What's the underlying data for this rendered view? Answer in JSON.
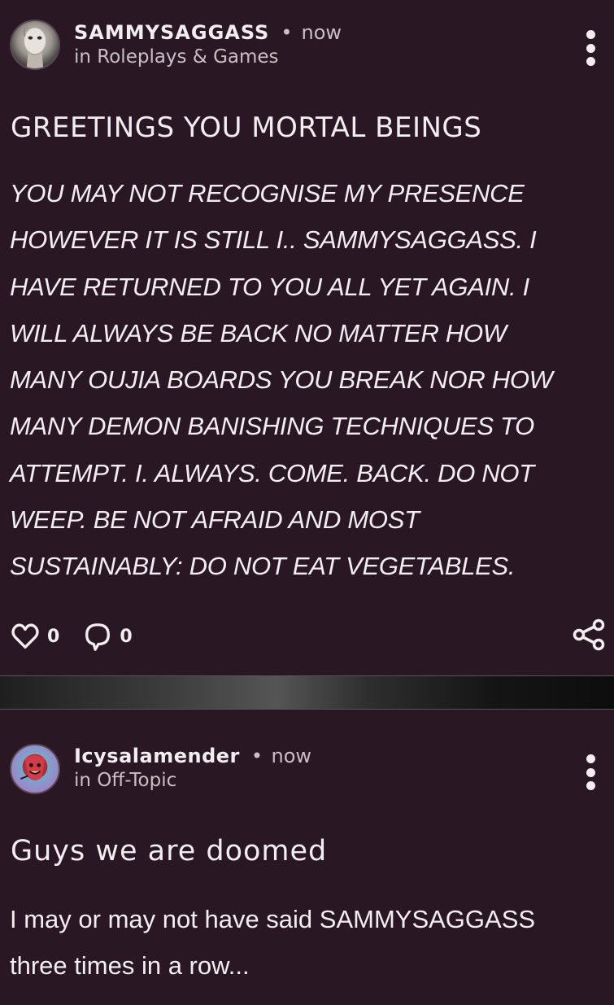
{
  "posts": [
    {
      "author": "SAMMYSAGGASS",
      "separator": "•",
      "time": "now",
      "community": "in Roleplays & Games",
      "title": "GREETINGS YOU MORTAL BEINGS",
      "body_lines": [
        "YOU MAY NOT RECOGNISE MY PRESENCE",
        "HOWEVER IT IS STILL I.. SAMMYSAGGASS. I",
        "HAVE RETURNED TO YOU ALL YET AGAIN. I",
        "WILL ALWAYS BE BACK NO MATTER HOW",
        "MANY OUJIA BOARDS YOU BREAK NOR HOW",
        "MANY DEMON BANISHING TECHNIQUES TO",
        "ATTEMPT. I. ALWAYS. COME. BACK. DO NOT",
        "WEEP. BE NOT AFRAID AND MOST",
        "SUSTAINABLY: DO NOT EAT VEGETABLES."
      ],
      "likes": "0",
      "comments": "0",
      "icons": [
        "heart-icon",
        "comment-icon",
        "share-icon",
        "more-icon"
      ]
    },
    {
      "author": "Icysalamender",
      "separator": "•",
      "time": "now",
      "community": "in Off-Topic",
      "title": "Guys we are doomed",
      "body_lines": [
        "I may or may not have said SAMMYSAGGASS",
        "three times in a row..."
      ]
    }
  ],
  "colors": {
    "background": "#2a1724",
    "text": "#f2eef0",
    "muted": "#c9bfc5"
  }
}
